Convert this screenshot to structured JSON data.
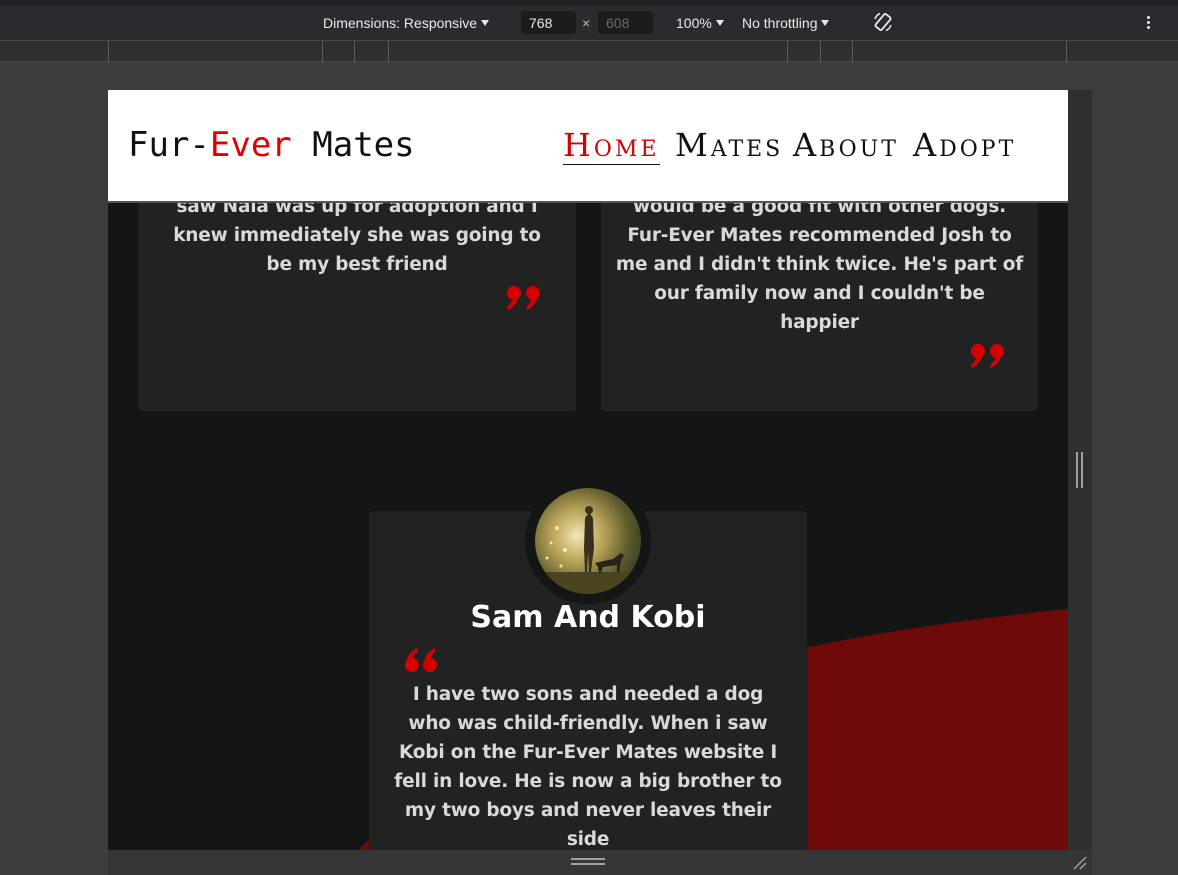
{
  "devtools": {
    "dimensions_label": "Dimensions: Responsive",
    "width_value": "768",
    "height_placeholder": "608",
    "times_sign": "×",
    "zoom_label": "100%",
    "throttling_label": "No throttling"
  },
  "site": {
    "logo": {
      "part1": "Fur-",
      "part2": "Ever",
      "part3": " Mates"
    },
    "nav": [
      {
        "label": "Home",
        "active": true
      },
      {
        "label": "Mates",
        "active": false
      },
      {
        "label": "About",
        "active": false
      },
      {
        "label": "Adopt",
        "active": false
      }
    ],
    "colors": {
      "accent": "#d50000",
      "wave": "#6e0a0a",
      "card": "#222222",
      "background": "#141515"
    }
  },
  "testimonials": [
    {
      "visible_lines": [
        "saw Nala was up for adoption and I",
        "knew immediately she was going to",
        "be my best friend"
      ]
    },
    {
      "visible_lines": [
        "would be a good fit with other dogs.",
        "Fur-Ever Mates recommended Josh to",
        "me and I didn't think twice. He's part of",
        "our family now and I couldn't be",
        "happier"
      ]
    },
    {
      "title": "Sam And Kobi",
      "visible_lines": [
        "I have two sons and needed a dog",
        "who was child-friendly. When i saw",
        "Kobi on the Fur-Ever Mates website I",
        "fell in love. He is now a big brother to",
        "my two boys and never leaves their",
        "side"
      ]
    }
  ]
}
